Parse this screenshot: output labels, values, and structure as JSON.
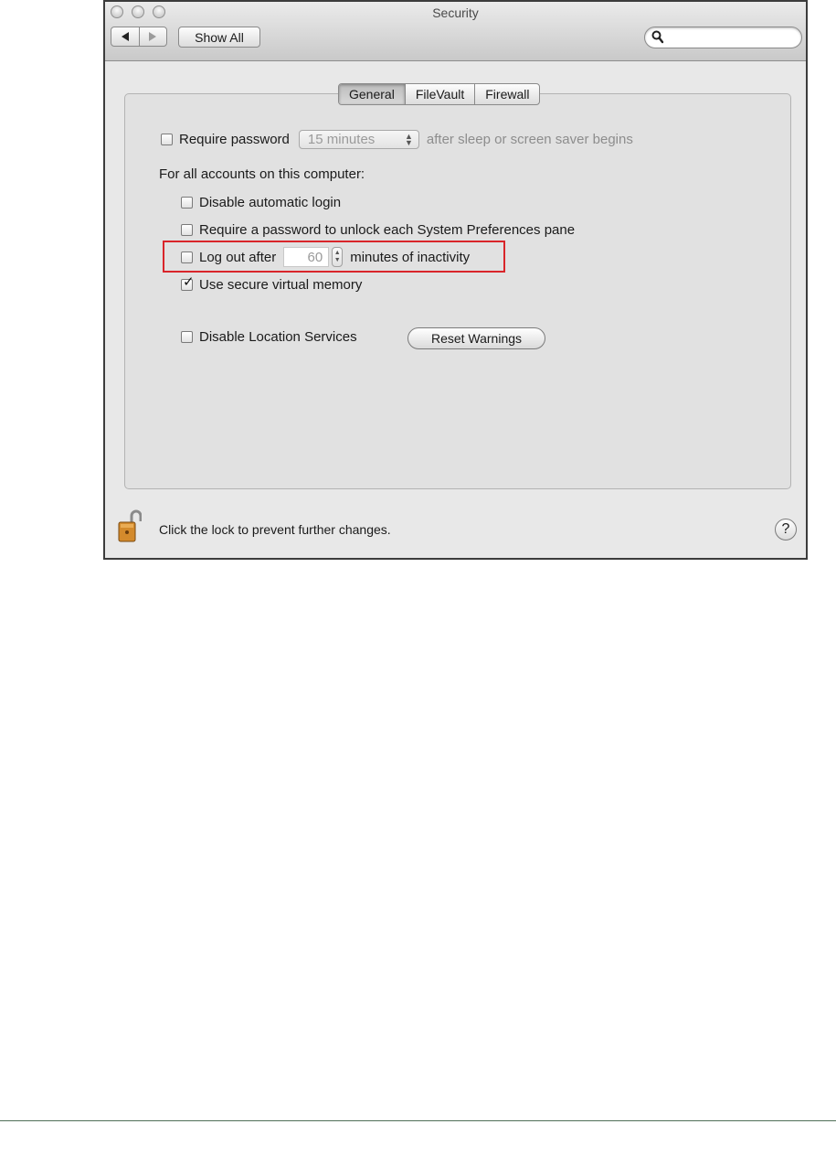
{
  "window": {
    "title": "Security",
    "show_all_label": "Show All",
    "search": {
      "value": "",
      "placeholder": ""
    }
  },
  "tabs": [
    {
      "label": "General",
      "selected": true
    },
    {
      "label": "FileVault",
      "selected": false
    },
    {
      "label": "Firewall",
      "selected": false
    }
  ],
  "general": {
    "require_password": {
      "label": "Require password",
      "checked": false,
      "interval": "15 minutes",
      "suffix": "after sleep or screen saver begins"
    },
    "accounts_heading": "For all accounts on this computer:",
    "disable_auto_login": {
      "label": "Disable automatic login",
      "checked": false
    },
    "require_unlock": {
      "label": "Require a password to unlock each System Preferences pane",
      "checked": false
    },
    "log_out": {
      "label": "Log out after",
      "minutes": "60",
      "suffix": "minutes of inactivity",
      "checked": false
    },
    "secure_vm": {
      "label": "Use secure virtual memory",
      "checked": true
    },
    "disable_location": {
      "label": "Disable Location Services",
      "checked": false
    },
    "reset_warnings_label": "Reset Warnings"
  },
  "bottom": {
    "lock_text": "Click the lock to prevent further changes.",
    "help_label": "?"
  },
  "colors": {
    "highlight": "#d9252a",
    "window_bg": "#e8e8e8"
  },
  "icons": {
    "lock": "open-lock-icon",
    "search": "magnifier-icon",
    "help": "question-mark-icon"
  }
}
